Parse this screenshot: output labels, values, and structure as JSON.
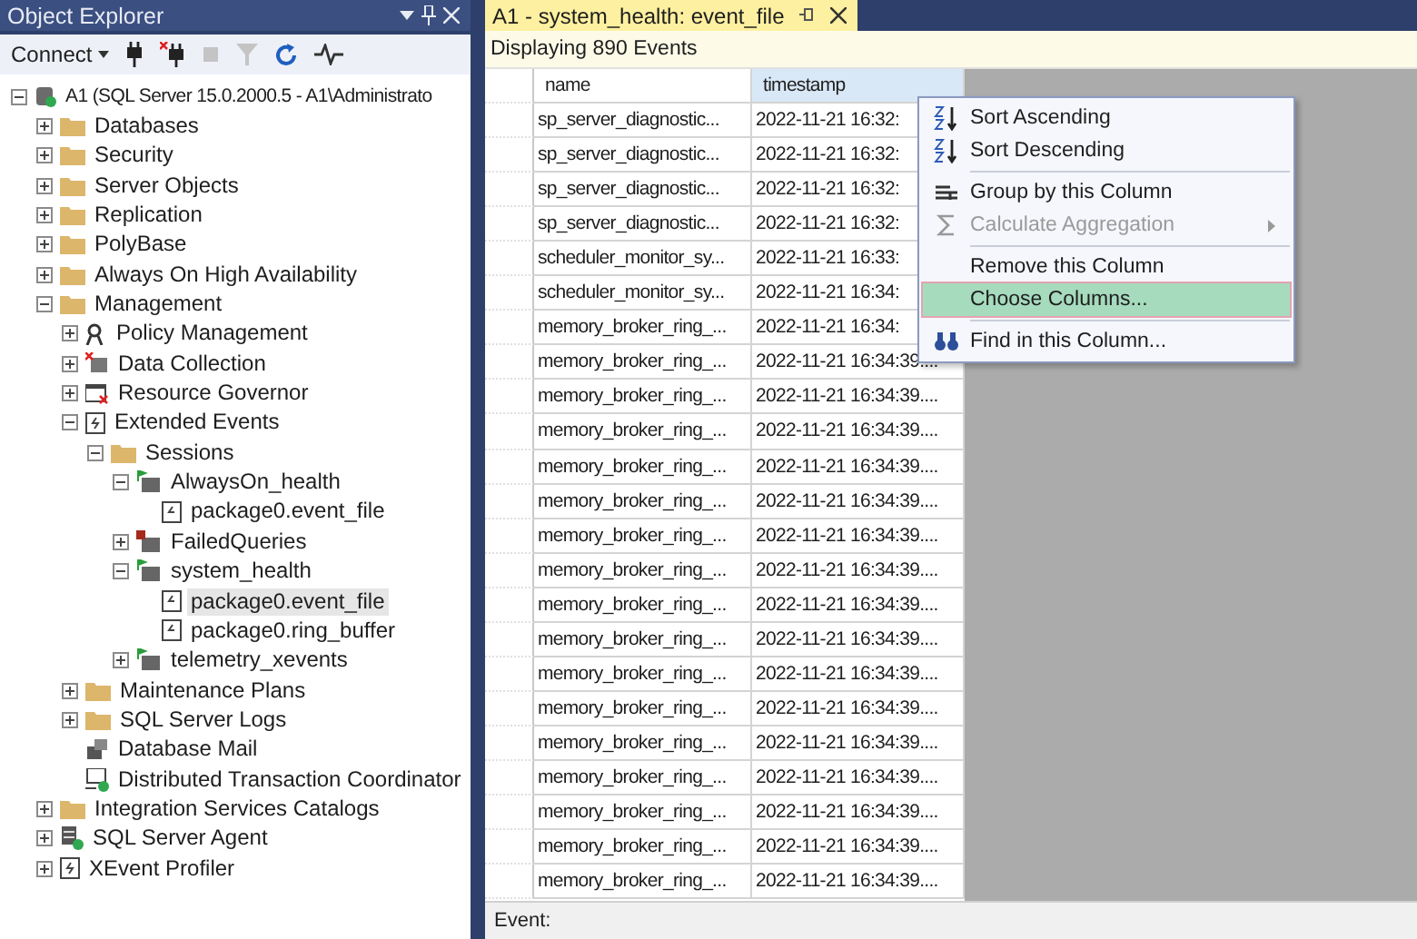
{
  "object_explorer": {
    "title": "Object Explorer",
    "toolbar": {
      "connect": "Connect"
    },
    "tree": [
      {
        "label": "A1 (SQL Server 15.0.2000.5 - A1\\Administrato",
        "kind": "server",
        "expanded": true,
        "selected": false,
        "children": [
          {
            "label": "Databases",
            "kind": "folder",
            "expanded": false,
            "selected": false
          },
          {
            "label": "Security",
            "kind": "folder",
            "expanded": false,
            "selected": false
          },
          {
            "label": "Server Objects",
            "kind": "folder",
            "expanded": false,
            "selected": false
          },
          {
            "label": "Replication",
            "kind": "folder",
            "expanded": false,
            "selected": false
          },
          {
            "label": "PolyBase",
            "kind": "folder",
            "expanded": false,
            "selected": false
          },
          {
            "label": "Always On High Availability",
            "kind": "folder",
            "expanded": false,
            "selected": false
          },
          {
            "label": "Management",
            "kind": "folder",
            "expanded": true,
            "selected": false,
            "children": [
              {
                "label": "Policy Management",
                "kind": "policy",
                "expanded": false,
                "selected": false
              },
              {
                "label": "Data Collection",
                "kind": "collection",
                "expanded": false,
                "selected": false
              },
              {
                "label": "Resource Governor",
                "kind": "governor",
                "expanded": false,
                "selected": false
              },
              {
                "label": "Extended Events",
                "kind": "xevent",
                "expanded": true,
                "selected": false,
                "children": [
                  {
                    "label": "Sessions",
                    "kind": "folder",
                    "expanded": true,
                    "selected": false,
                    "children": [
                      {
                        "label": "AlwaysOn_health",
                        "kind": "session",
                        "running": true,
                        "expanded": true,
                        "selected": false,
                        "children": [
                          {
                            "label": "package0.event_file",
                            "kind": "target",
                            "selected": false
                          }
                        ]
                      },
                      {
                        "label": "FailedQueries",
                        "kind": "session",
                        "running": false,
                        "expanded": false,
                        "selected": false
                      },
                      {
                        "label": "system_health",
                        "kind": "session",
                        "running": true,
                        "expanded": true,
                        "selected": false,
                        "children": [
                          {
                            "label": "package0.event_file",
                            "kind": "target",
                            "selected": true
                          },
                          {
                            "label": "package0.ring_buffer",
                            "kind": "target",
                            "selected": false
                          }
                        ]
                      },
                      {
                        "label": "telemetry_xevents",
                        "kind": "session",
                        "running": true,
                        "expanded": false,
                        "selected": false
                      }
                    ]
                  }
                ]
              },
              {
                "label": "Maintenance Plans",
                "kind": "folder",
                "expanded": false,
                "selected": false
              },
              {
                "label": "SQL Server Logs",
                "kind": "folder",
                "expanded": false,
                "selected": false
              },
              {
                "label": "Database Mail",
                "kind": "mail",
                "selected": false
              },
              {
                "label": "Distributed Transaction Coordinator",
                "kind": "dtc",
                "selected": false
              }
            ]
          },
          {
            "label": "Integration Services Catalogs",
            "kind": "folder",
            "expanded": false,
            "selected": false
          },
          {
            "label": "SQL Server Agent",
            "kind": "agent",
            "expanded": false,
            "selected": false
          },
          {
            "label": "XEvent Profiler",
            "kind": "xevent",
            "expanded": false,
            "selected": false
          }
        ]
      }
    ]
  },
  "document": {
    "tab": {
      "title": "A1 - system_health: event_file",
      "selected": true
    },
    "info": "Displaying 890 Events",
    "table": {
      "columns": [
        {
          "label": "name",
          "selected": false
        },
        {
          "label": "timestamp",
          "selected": true
        }
      ],
      "rows": [
        [
          "sp_server_diagnostic...",
          "2022-11-21 16:32:"
        ],
        [
          "sp_server_diagnostic...",
          "2022-11-21 16:32:"
        ],
        [
          "sp_server_diagnostic...",
          "2022-11-21 16:32:"
        ],
        [
          "sp_server_diagnostic...",
          "2022-11-21 16:32:"
        ],
        [
          "scheduler_monitor_sy...",
          "2022-11-21 16:33:"
        ],
        [
          "scheduler_monitor_sy...",
          "2022-11-21 16:34:"
        ],
        [
          "memory_broker_ring_...",
          "2022-11-21 16:34:"
        ],
        [
          "memory_broker_ring_...",
          "2022-11-21 16:34:39...."
        ],
        [
          "memory_broker_ring_...",
          "2022-11-21 16:34:39...."
        ],
        [
          "memory_broker_ring_...",
          "2022-11-21 16:34:39...."
        ],
        [
          "memory_broker_ring_...",
          "2022-11-21 16:34:39...."
        ],
        [
          "memory_broker_ring_...",
          "2022-11-21 16:34:39...."
        ],
        [
          "memory_broker_ring_...",
          "2022-11-21 16:34:39...."
        ],
        [
          "memory_broker_ring_...",
          "2022-11-21 16:34:39...."
        ],
        [
          "memory_broker_ring_...",
          "2022-11-21 16:34:39...."
        ],
        [
          "memory_broker_ring_...",
          "2022-11-21 16:34:39...."
        ],
        [
          "memory_broker_ring_...",
          "2022-11-21 16:34:39...."
        ],
        [
          "memory_broker_ring_...",
          "2022-11-21 16:34:39...."
        ],
        [
          "memory_broker_ring_...",
          "2022-11-21 16:34:39...."
        ],
        [
          "memory_broker_ring_...",
          "2022-11-21 16:34:39...."
        ],
        [
          "memory_broker_ring_...",
          "2022-11-21 16:34:39...."
        ],
        [
          "memory_broker_ring_...",
          "2022-11-21 16:34:39...."
        ],
        [
          "memory_broker_ring_...",
          "2022-11-21 16:34:39...."
        ]
      ]
    },
    "context_menu": [
      {
        "label": "Sort Ascending",
        "kind": "sort-asc",
        "disabled": false,
        "selected": false
      },
      {
        "label": "Sort Descending",
        "kind": "sort-desc",
        "disabled": false,
        "selected": false
      },
      {
        "kind": "separator"
      },
      {
        "label": "Group by this Column",
        "kind": "group",
        "disabled": false,
        "selected": false
      },
      {
        "label": "Calculate Aggregation",
        "kind": "sum",
        "disabled": true,
        "submenu": true,
        "selected": false
      },
      {
        "kind": "separator"
      },
      {
        "label": "Remove this Column",
        "kind": "plain",
        "disabled": false,
        "selected": false
      },
      {
        "label": "Choose Columns...",
        "kind": "plain",
        "disabled": false,
        "selected": true
      },
      {
        "kind": "separator"
      },
      {
        "label": "Find in this Column...",
        "kind": "find",
        "disabled": false,
        "selected": false
      }
    ],
    "details_label": "Event:"
  }
}
